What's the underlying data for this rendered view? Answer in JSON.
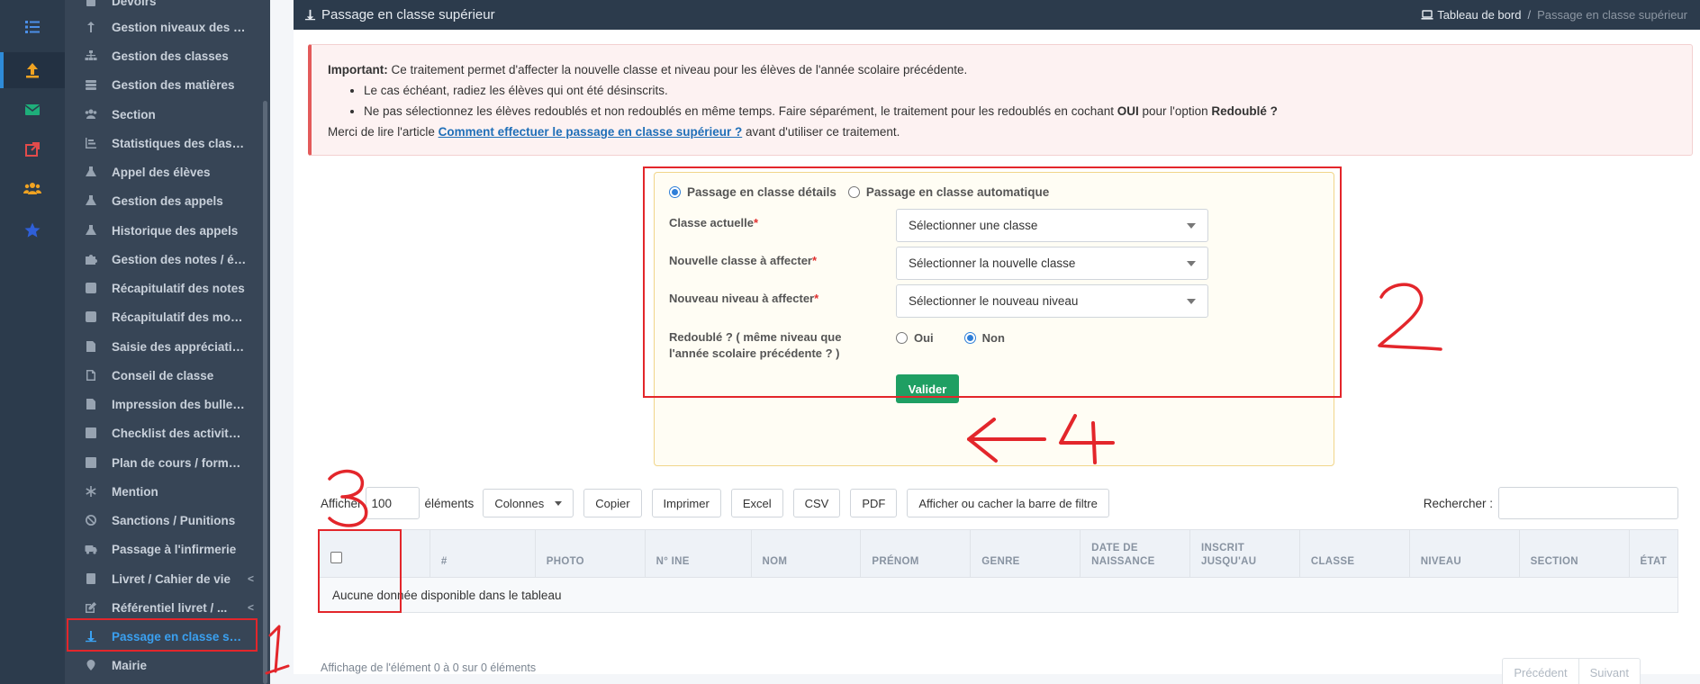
{
  "rail": {
    "items": [
      {
        "icon": "tasks-icon",
        "color": "#4b8fe8"
      },
      {
        "icon": "upload-icon",
        "color": "#f0a322"
      },
      {
        "icon": "envelope-icon",
        "color": "#1eae7a"
      },
      {
        "icon": "external-link-icon",
        "color": "#e24b4b"
      },
      {
        "icon": "users-icon",
        "color": "#f0a322"
      },
      {
        "icon": "star-icon",
        "color": "#2f5fd8"
      }
    ]
  },
  "sidebar": {
    "items": [
      {
        "label": "Devoirs",
        "icon": "book-icon"
      },
      {
        "label": "Gestion niveaux des cl...",
        "icon": "arrow-up-icon"
      },
      {
        "label": "Gestion des classes",
        "icon": "sitemap-icon"
      },
      {
        "label": "Gestion des matières",
        "icon": "database-icon"
      },
      {
        "label": "Section",
        "icon": "users-icon"
      },
      {
        "label": "Statistiques des classes",
        "icon": "bar-chart-icon"
      },
      {
        "label": "Appel des élèves",
        "icon": "flask-icon"
      },
      {
        "label": "Gestion des appels",
        "icon": "flask-icon"
      },
      {
        "label": "Historique des appels",
        "icon": "flask-icon"
      },
      {
        "label": "Gestion des notes / év...",
        "icon": "puzzle-icon"
      },
      {
        "label": "Récapitulatif des notes",
        "icon": "check-square-icon"
      },
      {
        "label": "Récapitulatif des moye...",
        "icon": "check-square-icon"
      },
      {
        "label": "Saisie des appréciations",
        "icon": "file-icon"
      },
      {
        "label": "Conseil de classe",
        "icon": "file-outline-icon"
      },
      {
        "label": "Impression des bulletins",
        "icon": "file-icon"
      },
      {
        "label": "Checklist des activités ...",
        "icon": "list-icon"
      },
      {
        "label": "Plan de cours / formati...",
        "icon": "list-icon"
      },
      {
        "label": "Mention",
        "icon": "asterisk-icon"
      },
      {
        "label": "Sanctions / Punitions",
        "icon": "ban-icon"
      },
      {
        "label": "Passage à l'infirmerie",
        "icon": "ambulance-icon"
      },
      {
        "label": "Livret / Cahier de vie",
        "icon": "book-icon",
        "chevron": "<"
      },
      {
        "label": "Référentiel livret / ...",
        "icon": "edit-icon",
        "chevron": "<"
      },
      {
        "label": "Passage en classe sup...",
        "icon": "level-up-icon",
        "active": true
      },
      {
        "label": "Mairie",
        "icon": "map-marker-icon"
      }
    ]
  },
  "topbar": {
    "title": "Passage en classe supérieur",
    "crumb_home": "Tableau de bord",
    "crumb_sep": "/",
    "crumb_current": "Passage en classe supérieur"
  },
  "alert": {
    "strong": "Important:",
    "text": " Ce traitement permet d'affecter la nouvelle classe et niveau pour les élèves de l'année scolaire précédente.",
    "bullet1": "Le cas échéant, radiez les élèves qui ont été désinscrits.",
    "bullet2_a": "Ne pas sélectionnez les élèves redoublés et non redoublés en même temps. Faire séparément, le traitement pour les redoublés en cochant ",
    "bullet2_b": "OUI",
    "bullet2_c": " pour l'option ",
    "bullet2_d": "Redoublé ?",
    "footer_a": "Merci de lire l'article ",
    "footer_link": "Comment effectuer le passage en classe supérieur ?",
    "footer_b": " avant d'utiliser ce traitement."
  },
  "form": {
    "mode_details": "Passage en classe détails",
    "mode_auto": "Passage en classe automatique",
    "classe_actuelle": "Classe actuelle",
    "classe_actuelle_placeholder": "Sélectionner une classe",
    "nouvelle_classe": "Nouvelle classe à affecter",
    "nouvelle_classe_placeholder": "Sélectionner la nouvelle classe",
    "nouveau_niveau": "Nouveau niveau à affecter",
    "nouveau_niveau_placeholder": "Sélectionner le nouveau niveau",
    "redouble_label_1": "Redoublé ? ( même niveau que",
    "redouble_label_2": "l'année scolaire précédente ? )",
    "oui": "Oui",
    "non": "Non",
    "required_mark": "*",
    "submit": "Valider"
  },
  "toolbar": {
    "show_prefix": "Afficher",
    "length": "100",
    "show_suffix": "éléments",
    "colonnes": "Colonnes",
    "copier": "Copier",
    "imprimer": "Imprimer",
    "excel": "Excel",
    "csv": "CSV",
    "pdf": "PDF",
    "filtre": "Afficher ou cacher la barre de filtre",
    "search_label": "Rechercher :"
  },
  "table": {
    "columns": [
      "#",
      "PHOTO",
      "N° INE",
      "NOM",
      "PRÉNOM",
      "GENRE",
      "DATE DE NAISSANCE",
      "INSCRIT JUSQU'AU",
      "CLASSE",
      "NIVEAU",
      "SECTION",
      "ÉTAT"
    ],
    "empty": "Aucune donnée disponible dans le tableau"
  },
  "footer": {
    "info": "Affichage de l'élément 0 à 0 sur 0 éléments",
    "prev": "Précédent",
    "next": "Suivant"
  },
  "annotations": {
    "n1": "1",
    "n2": "2",
    "n3": "3",
    "n4": "4"
  }
}
